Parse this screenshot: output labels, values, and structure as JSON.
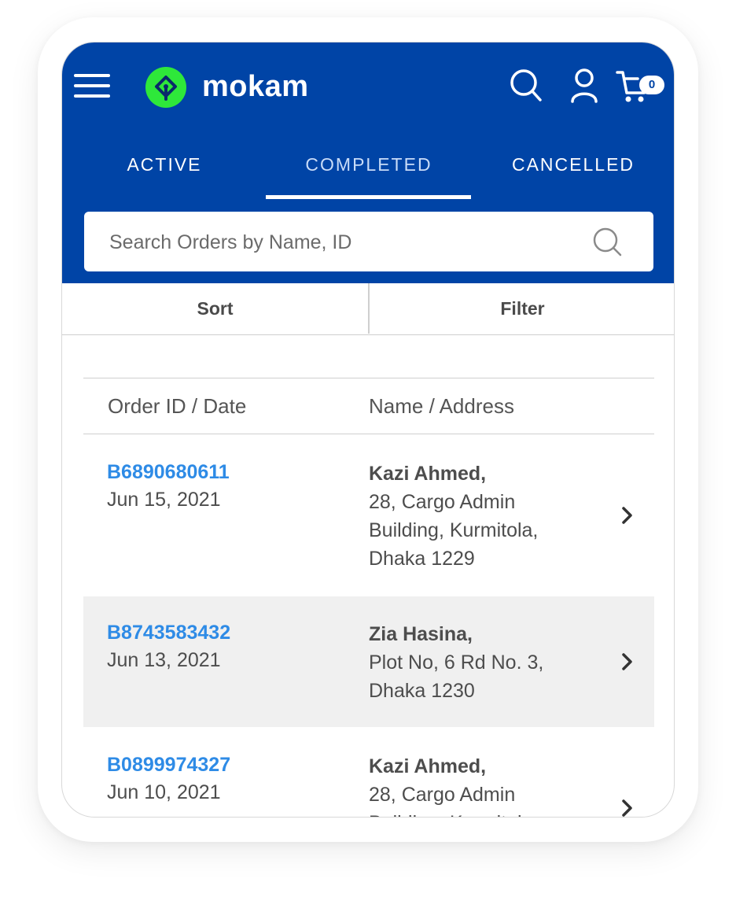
{
  "header": {
    "brand": "mokam",
    "cart_count": "0",
    "colors": {
      "primary": "#0044a6",
      "logo_green": "#2ee83a",
      "link_blue": "#2e8be6"
    }
  },
  "tabs": [
    {
      "label": "ACTIVE"
    },
    {
      "label": "COMPLETED",
      "active": true
    },
    {
      "label": "CANCELLED"
    }
  ],
  "search": {
    "placeholder": "Search Orders by Name, ID",
    "value": ""
  },
  "toolbar": {
    "sort_label": "Sort",
    "filter_label": "Filter"
  },
  "table": {
    "col_order": "Order ID / Date",
    "col_name": "Name / Address"
  },
  "orders": [
    {
      "id": "B6890680611",
      "date": "Jun 15, 2021",
      "name": "Kazi Ahmed,",
      "address_lines": [
        "28, Cargo Admin",
        "Building, Kurmitola,",
        "Dhaka 1229"
      ]
    },
    {
      "id": "B8743583432",
      "date": "Jun 13, 2021",
      "name": "Zia Hasina,",
      "address_lines": [
        "Plot No, 6 Rd No. 3,",
        "Dhaka 1230"
      ]
    },
    {
      "id": "B0899974327",
      "date": "Jun 10, 2021",
      "name": "Kazi Ahmed,",
      "address_lines": [
        "28, Cargo Admin",
        "Building, Kurmitola,"
      ]
    }
  ]
}
